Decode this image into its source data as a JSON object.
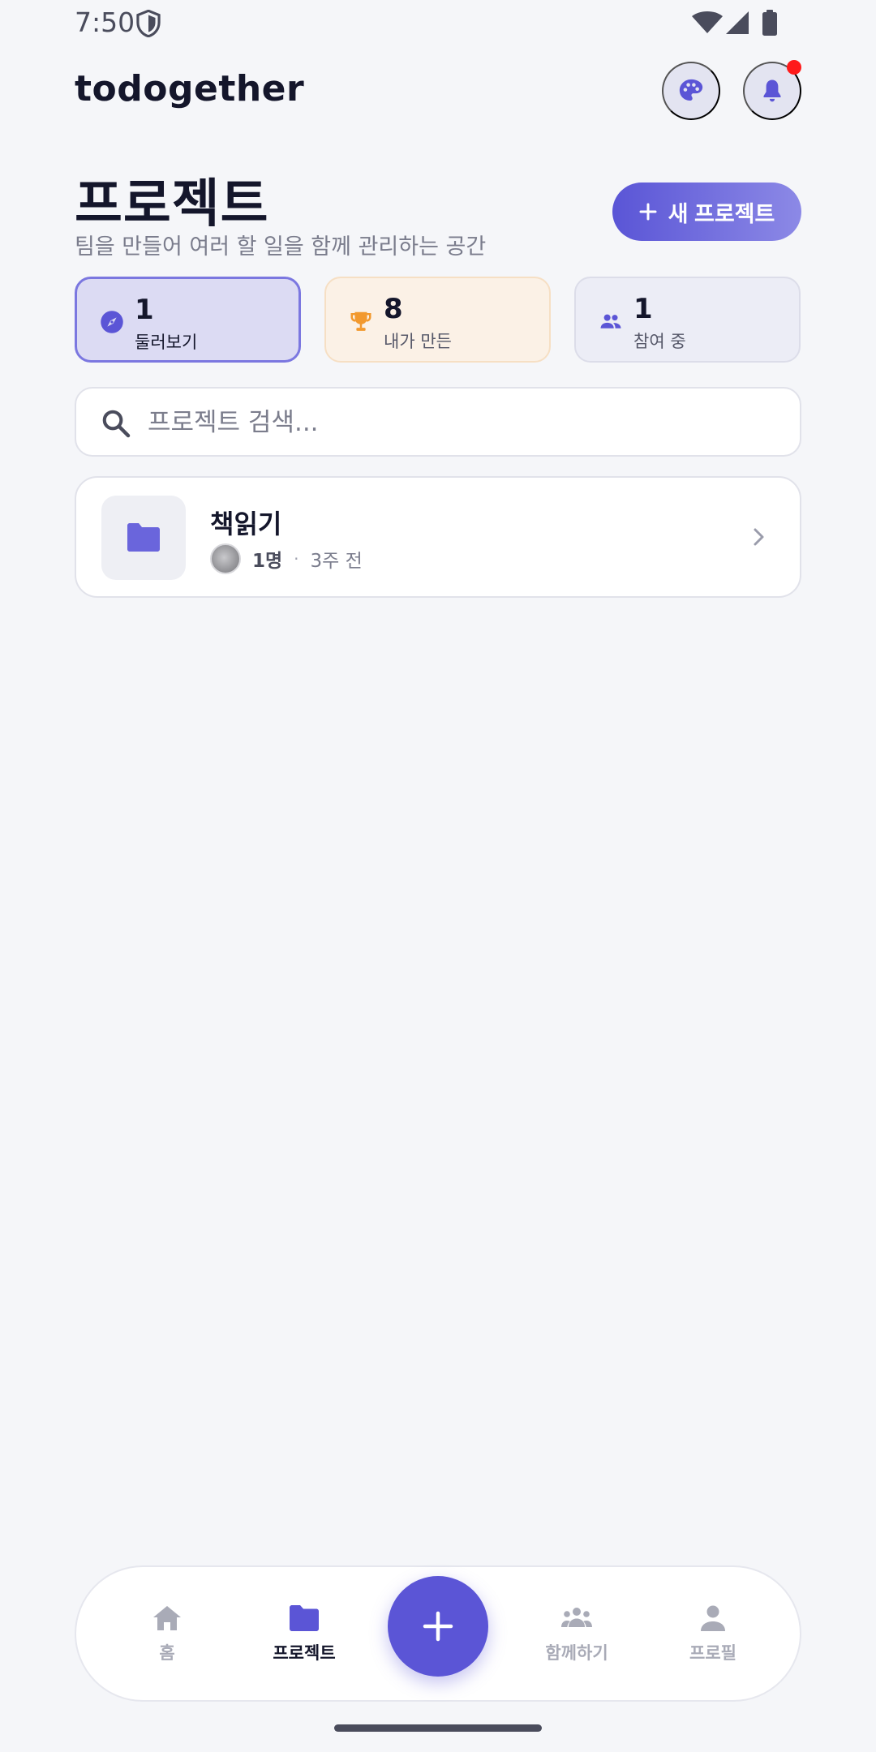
{
  "status_bar": {
    "time": "7:50"
  },
  "header": {
    "app_title": "todogether"
  },
  "page": {
    "title": "프로젝트",
    "subtitle": "팀을 만들어 여러 할 일을 함께 관리하는 공간",
    "new_project_label": "새 프로젝트"
  },
  "stats": [
    {
      "value": "1",
      "label": "둘러보기",
      "icon": "compass-icon",
      "color": "#5b55d6"
    },
    {
      "value": "8",
      "label": "내가 만든",
      "icon": "trophy-icon",
      "color": "#f2992e"
    },
    {
      "value": "1",
      "label": "참여 중",
      "icon": "group-icon",
      "color": "#5b55d6"
    }
  ],
  "search": {
    "placeholder": "프로젝트 검색..."
  },
  "projects": [
    {
      "name": "책읽기",
      "members": "1명",
      "updated": "3주 전",
      "icon": "folder-icon"
    }
  ],
  "bottom_nav": {
    "items": [
      {
        "label": "홈",
        "icon": "home-icon",
        "active": false
      },
      {
        "label": "프로젝트",
        "icon": "folder-icon",
        "active": true
      },
      {
        "label": "함께하기",
        "icon": "group-icon",
        "active": false
      },
      {
        "label": "프로필",
        "icon": "person-icon",
        "active": false
      }
    ]
  },
  "colors": {
    "accent": "#5b55d6",
    "background": "#f5f6f9",
    "notification": "#ff1a1a",
    "text_primary": "#14162b",
    "text_muted": "#7a7c8c"
  }
}
